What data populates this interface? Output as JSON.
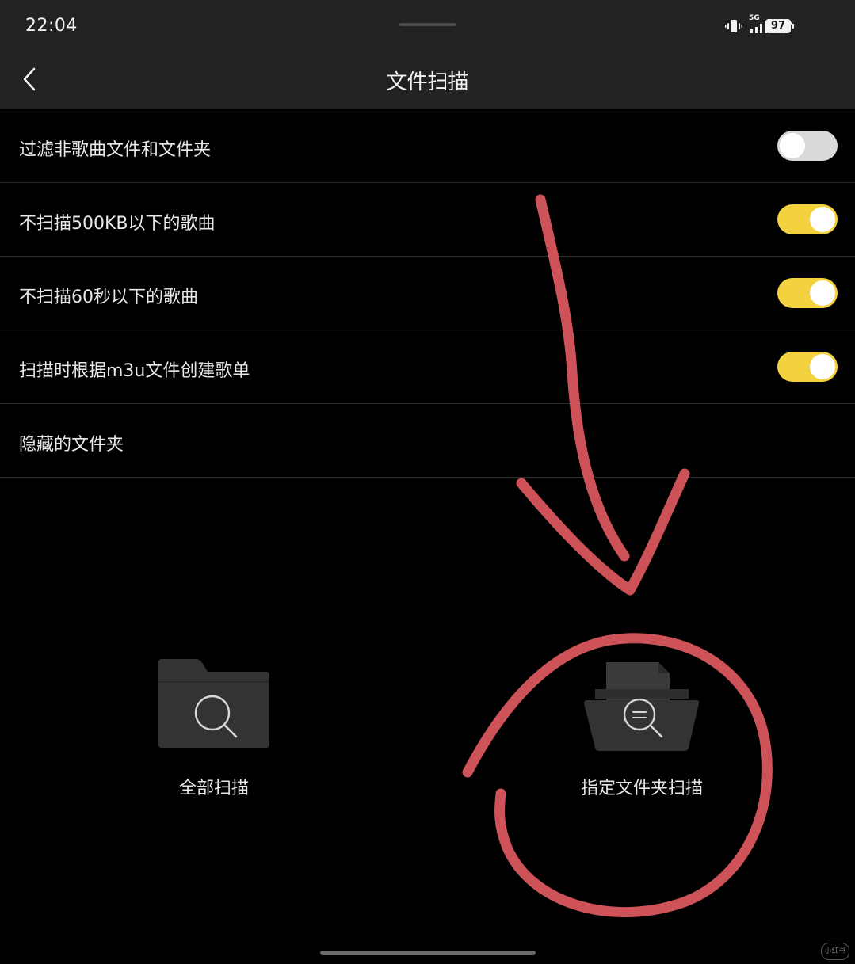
{
  "status_bar": {
    "time": "22:04",
    "network": "5G",
    "battery": "97",
    "icons": [
      "vibrate-icon",
      "signal-icon",
      "wifi-icon",
      "battery-icon"
    ]
  },
  "nav": {
    "title": "文件扫描",
    "back_icon": "chevron-left-icon"
  },
  "settings": [
    {
      "label": "过滤非歌曲文件和文件夹",
      "toggle": false
    },
    {
      "label": "不扫描500KB以下的歌曲",
      "toggle": true
    },
    {
      "label": "不扫描60秒以下的歌曲",
      "toggle": true
    },
    {
      "label": "扫描时根据m3u文件创建歌单",
      "toggle": true
    },
    {
      "label": "隐藏的文件夹"
    }
  ],
  "scan_options": [
    {
      "label": "全部扫描",
      "icon": "folder-search-icon"
    },
    {
      "label": "指定文件夹扫描",
      "icon": "open-folder-search-icon"
    }
  ],
  "colors": {
    "background": "#000000",
    "bar": "#222222",
    "toggle_on": "#f4d13e",
    "toggle_off": "#d9d9d9",
    "annotation": "#d9575d"
  }
}
